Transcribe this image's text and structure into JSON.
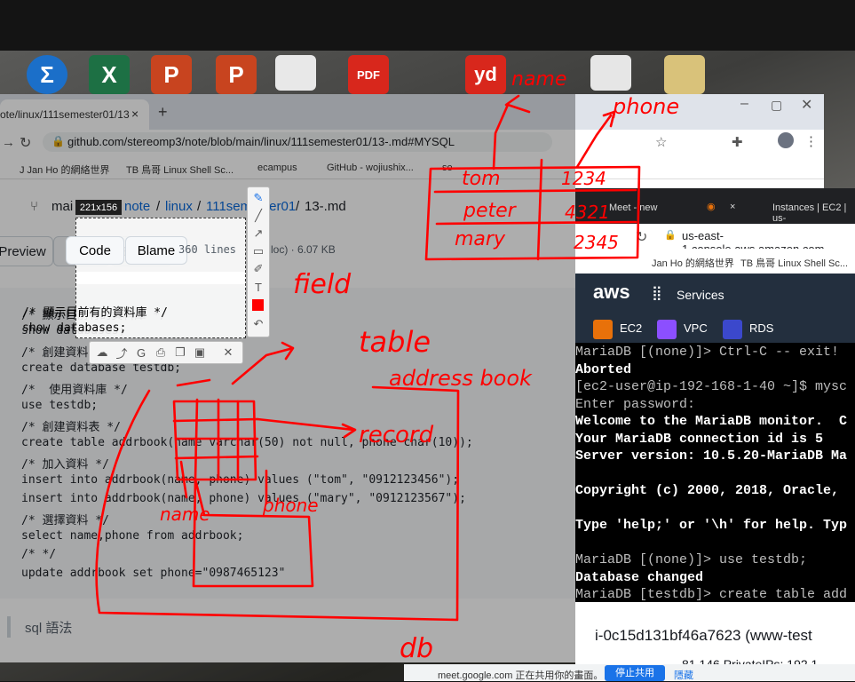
{
  "browser": {
    "tab_title": "ote/linux/111semester01/13",
    "tab_close": "×",
    "new_tab": "+",
    "url": "github.com/stereomp3/note/blob/main/linux/111semester01/13-.md#MYSQL",
    "bookmarks": [
      "J  Jan Ho 的網絡世界",
      "TB  鳥哥 Linux Shell Sc...",
      "ecampus",
      "GitHub - wojiushix...",
      "se"
    ]
  },
  "github": {
    "branch": "mai",
    "breadcrumb": [
      "note",
      "/",
      "linux",
      "/",
      "111semester01",
      "/",
      "13-.md"
    ],
    "tabs": [
      "Preview",
      "Code",
      "Blame"
    ],
    "lines_info": "360 lines",
    "meta": "loc) · 6.07 KB",
    "code_lines": [
      "/* 顯示目前有的資料庫 */",
      "show databases;",
      "/* 創建資料庫 */",
      "create database testdb;",
      "/*  使用資料庫 */",
      "use testdb;",
      "/* 創建資料表 */",
      "create table addrbook(name varchar(50) not null, phone char(10));",
      "/* 加入資料 */",
      "insert into addrbook(name, phone) values (\"tom\", \"0912123456\");",
      "insert into addrbook(name, phone) values (\"mary\", \"0912123567\");",
      "/* 選擇資料 */",
      "select name,phone from addrbook;",
      "/* */",
      "update addrbook set phone=\"0987465123\""
    ],
    "section_heading": "sql 語法"
  },
  "snip": {
    "size_label": "221x156"
  },
  "aws": {
    "tabs": [
      "Meet - new",
      "×",
      "Instances | EC2 | us-"
    ],
    "url": "us-east-1.console.aws.amazon.com",
    "bookmarks": [
      "Jan Ho 的網絡世界",
      "TB  鳥哥 Linux Shell Sc..."
    ],
    "logo": "aws",
    "services": "Services",
    "service_links": [
      "EC2",
      "VPC",
      "RDS"
    ],
    "terminal": [
      {
        "text": "MariaDB [(none)]> Ctrl-C -- exit!",
        "bold": false
      },
      {
        "text": "Aborted",
        "bold": true
      },
      {
        "text": "[ec2-user@ip-192-168-1-40 ~]$ mysc",
        "bold": false
      },
      {
        "text": "Enter password:",
        "bold": false
      },
      {
        "text": "Welcome to the MariaDB monitor.  C",
        "bold": true
      },
      {
        "text": "Your MariaDB connection id is 5",
        "bold": true
      },
      {
        "text": "Server version: 10.5.20-MariaDB Ma",
        "bold": true
      },
      {
        "text": "",
        "bold": false
      },
      {
        "text": "Copyright (c) 2000, 2018, Oracle,",
        "bold": true
      },
      {
        "text": "",
        "bold": false
      },
      {
        "text": "Type 'help;' or '\\h' for help. Typ",
        "bold": true
      },
      {
        "text": "",
        "bold": false
      },
      {
        "text": "MariaDB [(none)]> use testdb;",
        "bold": false
      },
      {
        "text": "Database changed",
        "bold": true
      },
      {
        "text": "MariaDB [testdb]> create table add",
        "bold": false
      }
    ],
    "instance_id": "i-0c15d131bf46a7623 (www-test",
    "ips": "81.146    PrivateIPs: 192.1"
  },
  "meet": {
    "share_text": "meet.google.com 正在共用你的畫面。",
    "stop_button": "停止共用",
    "hide_button": "隱藏"
  },
  "annotations": {
    "name_top": "name",
    "phone_top": "phone",
    "table_rows": [
      [
        "tom",
        "1234"
      ],
      [
        "peter",
        "4321"
      ],
      [
        "mary",
        "2345"
      ]
    ],
    "field": "field",
    "table": "table",
    "addressbook": "address book",
    "record": "record",
    "name_bottom": "name",
    "phone_bottom": "phone",
    "db": "db"
  }
}
